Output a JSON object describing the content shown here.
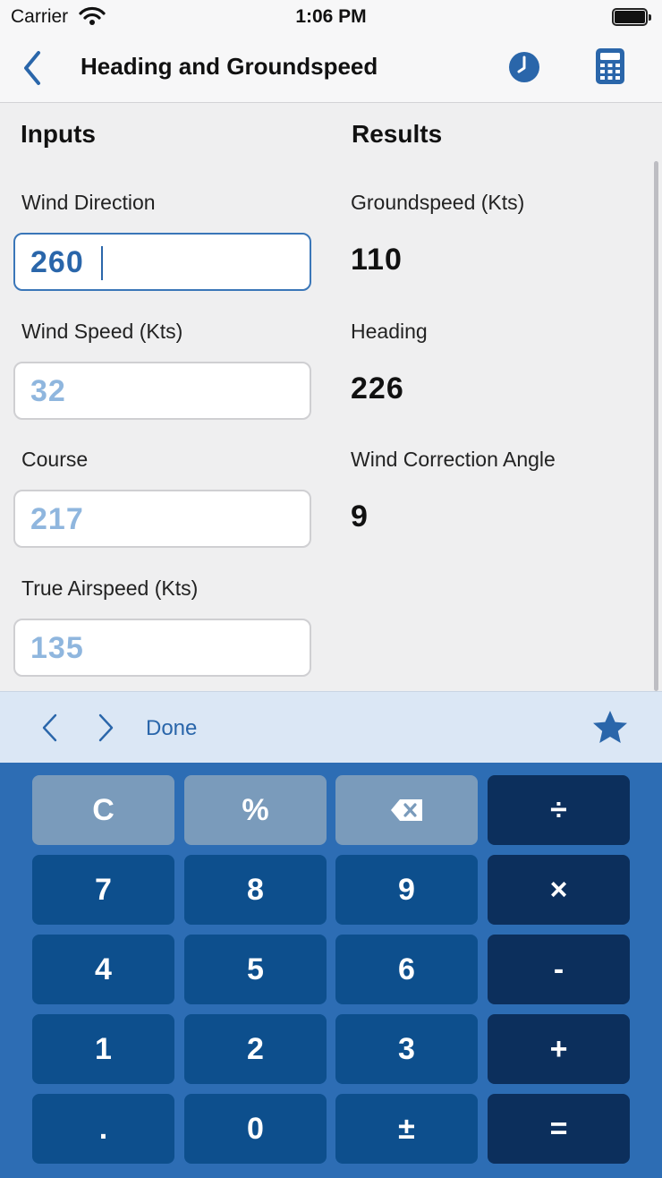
{
  "status_bar": {
    "carrier": "Carrier",
    "time": "1:06 PM"
  },
  "nav": {
    "title": "Heading and Groundspeed"
  },
  "inputs": {
    "heading": "Inputs",
    "wind_direction": {
      "label": "Wind Direction",
      "value": "260"
    },
    "wind_speed": {
      "label": "Wind Speed (Kts)",
      "value": "32"
    },
    "course": {
      "label": "Course",
      "value": "217"
    },
    "true_airspeed": {
      "label": "True Airspeed (Kts)",
      "value": "135"
    }
  },
  "results": {
    "heading": "Results",
    "groundspeed": {
      "label": "Groundspeed (Kts)",
      "value": "110"
    },
    "heading_result": {
      "label": "Heading",
      "value": "226"
    },
    "wca": {
      "label": "Wind Correction Angle",
      "value": "9"
    }
  },
  "accessory": {
    "done_label": "Done"
  },
  "keypad": {
    "clear": "C",
    "percent": "%",
    "divide": "÷",
    "k7": "7",
    "k8": "8",
    "k9": "9",
    "multiply": "×",
    "k4": "4",
    "k5": "5",
    "k6": "6",
    "minus": "-",
    "k1": "1",
    "k2": "2",
    "k3": "3",
    "plus": "+",
    "decimal": ".",
    "k0": "0",
    "plusminus": "±",
    "equals": "="
  },
  "colors": {
    "accent": "#2a66aa",
    "keypad_bg": "#2d6db4",
    "key_number": "#0d4f8d",
    "key_operator": "#0c2f5c",
    "key_utility": "#7a9bbb",
    "placeholder_value": "#8fb6de"
  },
  "icons": [
    "chevron-left-icon",
    "clock-icon",
    "calculator-icon",
    "wifi-icon",
    "battery-icon",
    "star-icon",
    "backspace-icon"
  ]
}
